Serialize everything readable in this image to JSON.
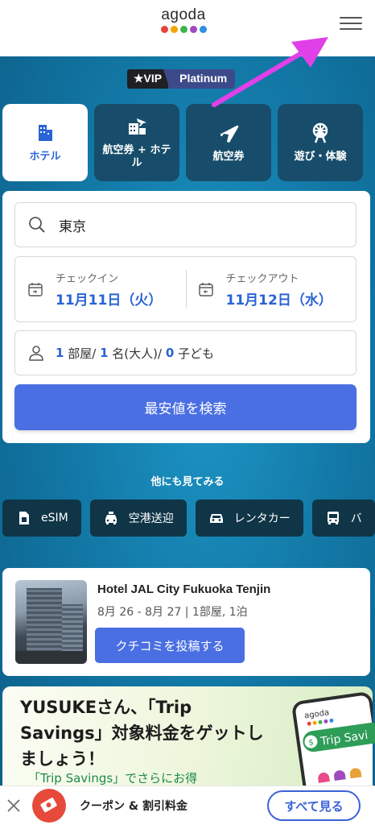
{
  "header": {
    "logo_text": "agoda",
    "logo_dots": [
      "#e8433a",
      "#f7a300",
      "#3fb449",
      "#9d4bbf",
      "#2f8ee0"
    ]
  },
  "vip": {
    "label": "★VIP",
    "tier": "Platinum"
  },
  "tabs": [
    {
      "label": "ホテル",
      "icon": "hotel-icon",
      "active": true
    },
    {
      "label": "航空券 + ホテル",
      "icon": "flight-hotel-icon",
      "active": false
    },
    {
      "label": "航空券",
      "icon": "airplane-icon",
      "active": false
    },
    {
      "label": "遊び・体験",
      "icon": "ferris-wheel-icon",
      "active": false
    }
  ],
  "search": {
    "destination": "東京",
    "checkin_label": "チェックイン",
    "checkin_date": "11月11日（火）",
    "checkout_label": "チェックアウト",
    "checkout_date": "11月12日（水）",
    "rooms": "1",
    "rooms_label": "部屋/",
    "adults": "1",
    "adults_label": "名(大人)/",
    "children": "0",
    "children_label": "子ども",
    "button": "最安値を検索"
  },
  "also": {
    "title": "他にも見てみる",
    "chips": [
      "eSIM",
      "空港送迎",
      "レンタカー",
      "バ"
    ]
  },
  "recent": {
    "hotel": "Hotel JAL City Fukuoka Tenjin",
    "details": "8月 26 - 8月 27 | 1部屋, 1泊",
    "button": "クチコミを投稿する"
  },
  "promo": {
    "title": "YUSUKEさん、「Trip Savings」対象料金をゲットしましょう！",
    "subtitle": "「Trip Savings」でさらにお得",
    "phone_logo": "agoda",
    "badge": "Trip Savi"
  },
  "banner": {
    "text": "クーポン & 割引料金",
    "button": "すべて見る"
  },
  "colors": {
    "accent": "#4a6fe3",
    "link_blue": "#2a63d6",
    "annotation_arrow": "#e040e8"
  }
}
